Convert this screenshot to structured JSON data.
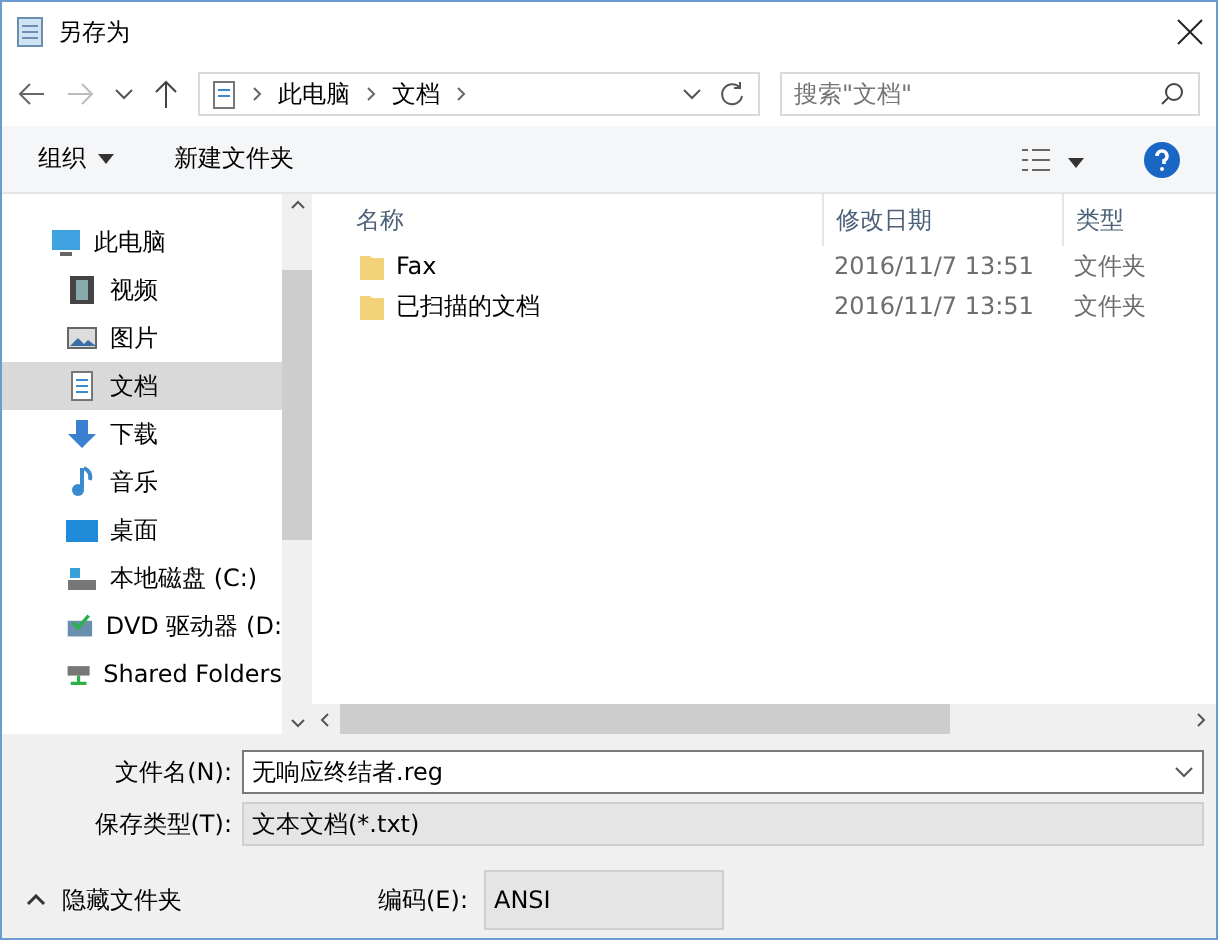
{
  "window": {
    "title": "另存为"
  },
  "breadcrumb": [
    "此电脑",
    "文档"
  ],
  "search": {
    "placeholder": "搜索\"文档\""
  },
  "toolbar": {
    "organize": "组织",
    "new_folder": "新建文件夹"
  },
  "sidebar": {
    "items": [
      {
        "label": "此电脑",
        "selected": false
      },
      {
        "label": "视频",
        "selected": false
      },
      {
        "label": "图片",
        "selected": false
      },
      {
        "label": "文档",
        "selected": true
      },
      {
        "label": "下载",
        "selected": false
      },
      {
        "label": "音乐",
        "selected": false
      },
      {
        "label": "桌面",
        "selected": false
      },
      {
        "label": "本地磁盘 (C:)",
        "selected": false
      },
      {
        "label": "DVD 驱动器 (D:",
        "selected": false
      },
      {
        "label": "Shared Folders",
        "selected": false
      }
    ]
  },
  "table": {
    "columns": [
      "名称",
      "修改日期",
      "类型"
    ],
    "rows": [
      {
        "name": "Fax",
        "modified": "2016/11/7 13:51",
        "type": "文件夹"
      },
      {
        "name": "已扫描的文档",
        "modified": "2016/11/7 13:51",
        "type": "文件夹"
      }
    ]
  },
  "form": {
    "filename_label": "文件名(N):",
    "filename": "无响应终结者.reg",
    "type_label": "保存类型(T):",
    "type": "文本文档(*.txt)",
    "encoding_label": "编码(E):",
    "encoding": "ANSI"
  },
  "hide_folders": "隐藏文件夹"
}
